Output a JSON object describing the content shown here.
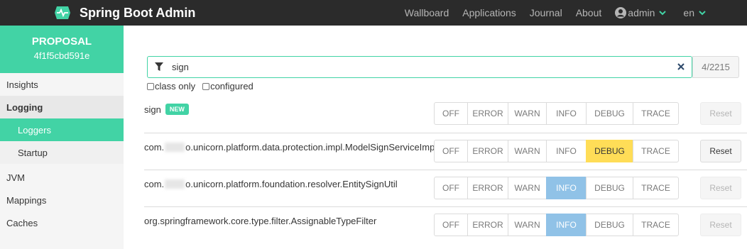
{
  "app": {
    "title": "Spring Boot Admin",
    "logo_icon": "heartbeat-icon"
  },
  "nav": {
    "items": [
      "Wallboard",
      "Applications",
      "Journal",
      "About"
    ],
    "user": "admin",
    "language": "en"
  },
  "sidebar": {
    "instance_name": "PROPOSAL",
    "instance_id": "4f1f5cbd591e",
    "items": [
      "Insights",
      "Logging",
      "JVM",
      "Mappings",
      "Caches"
    ],
    "logging_sub": [
      "Loggers",
      "Startup"
    ]
  },
  "search": {
    "value": "sign",
    "count": "4/2215"
  },
  "options": {
    "class_only": "class only",
    "configured": "configured"
  },
  "levels": [
    "OFF",
    "ERROR",
    "WARN",
    "INFO",
    "DEBUG",
    "TRACE"
  ],
  "reset_label": "Reset",
  "loggers": [
    {
      "name": "sign",
      "badge": "NEW",
      "active": null,
      "reset_enabled": false
    },
    {
      "name_prefix": "com.",
      "name_suffix": "o.unicorn.platform.data.protection.impl.ModelSignServiceImpl",
      "active": "DEBUG",
      "reset_enabled": true
    },
    {
      "name_prefix": "com.",
      "name_suffix": "o.unicorn.platform.foundation.resolver.EntitySignUtil",
      "active": "INFO",
      "reset_enabled": false
    },
    {
      "name": "org.springframework.core.type.filter.AssignableTypeFilter",
      "active": "INFO",
      "reset_enabled": false
    }
  ],
  "colors": {
    "accent": "#42d3a5",
    "info": "#90c2e7",
    "debug": "#ffdd57",
    "topbar": "#2b2b2b"
  }
}
